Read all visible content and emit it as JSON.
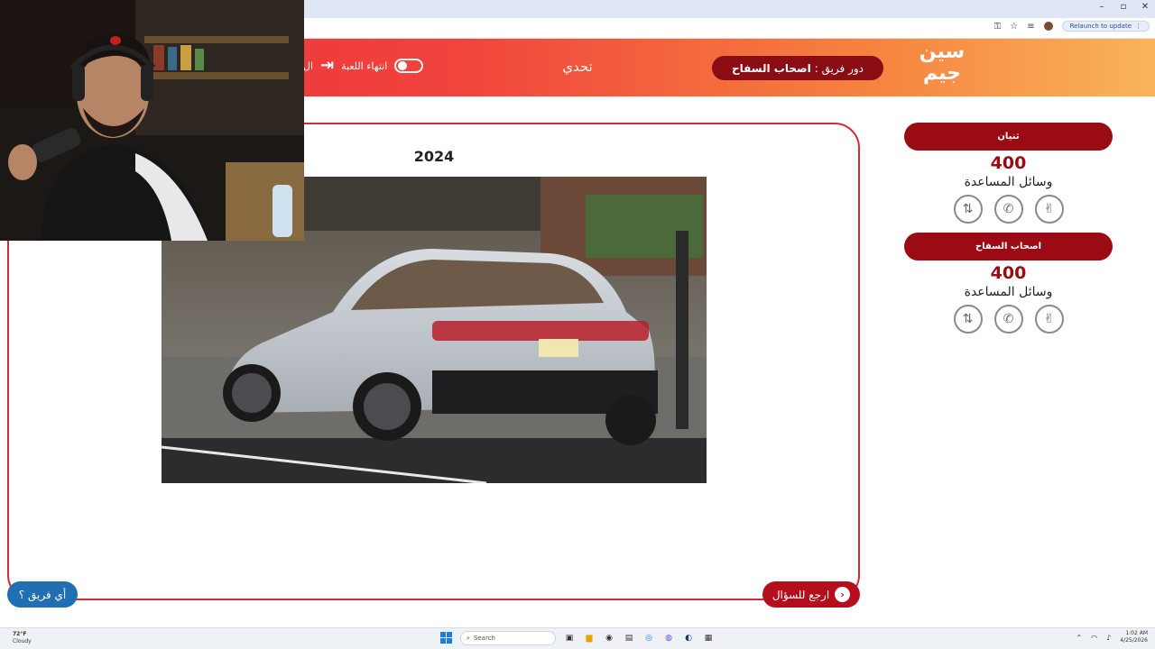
{
  "browser": {
    "window_controls": {
      "minimize": "–",
      "maximize": "▫",
      "close": "✕"
    },
    "relaunch_label": "Relaunch to update"
  },
  "header": {
    "logo_line1": "سين",
    "logo_line2": "جيم",
    "turn_prefix": "دور فريق :",
    "turn_team": "اصحاب السفاح",
    "mode_title": "تحدي",
    "end_game_label": "انتهاء اللعبة",
    "exit_fragment": "ال"
  },
  "question": {
    "year": "2024",
    "image_description_icon": "car-photo",
    "back_button_label": "ارجع للسؤال",
    "which_team_label": "أي فريق ؟"
  },
  "teams": [
    {
      "name": "ثنيان",
      "score": "400",
      "aids_label": "وسائل المساعدة",
      "aids": [
        "hand-icon",
        "phone-icon",
        "swap-icon"
      ]
    },
    {
      "name": "اصحاب السفاح",
      "score": "400",
      "aids_label": "وسائل المساعدة",
      "aids": [
        "hand-icon",
        "phone-icon",
        "swap-icon"
      ]
    }
  ],
  "taskbar": {
    "weather_temp": "72°F",
    "weather_desc": "Cloudy",
    "search_placeholder": "Search",
    "time": "1:02 AM",
    "date": "4/25/2026"
  },
  "colors": {
    "accent_red": "#9a0b14",
    "card_border": "#d42a3a",
    "which_button": "#1f6fb2"
  }
}
